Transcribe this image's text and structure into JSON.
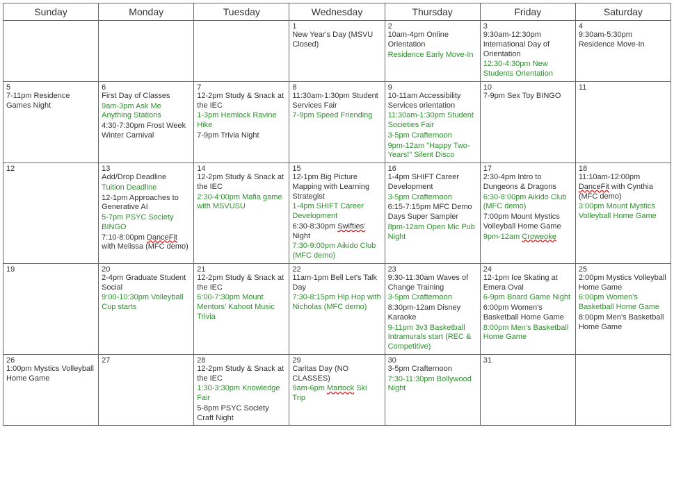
{
  "headers": [
    "Sunday",
    "Monday",
    "Tuesday",
    "Wednesday",
    "Thursday",
    "Friday",
    "Saturday"
  ],
  "weeks": [
    [
      {
        "num": "",
        "events": []
      },
      {
        "num": "",
        "events": []
      },
      {
        "num": "",
        "events": []
      },
      {
        "num": "1",
        "events": [
          {
            "text": "New Year's Day (MSVU Closed)",
            "color": "blk"
          }
        ]
      },
      {
        "num": "2",
        "events": [
          {
            "text": "10am-4pm Online Orientation",
            "color": "blk"
          },
          {
            "text": "Residence Early Move-In",
            "color": "grn"
          }
        ]
      },
      {
        "num": "3",
        "events": [
          {
            "text": "9:30am-12:30pm International Day of Orientation",
            "color": "blk"
          },
          {
            "text": "12:30-4:30pm New Students Orientation",
            "color": "grn"
          }
        ]
      },
      {
        "num": "4",
        "events": [
          {
            "text": "9:30am-5:30pm Residence Move-In",
            "color": "blk"
          }
        ]
      }
    ],
    [
      {
        "num": "5",
        "events": [
          {
            "text": "7-11pm Residence Games Night",
            "color": "blk"
          }
        ]
      },
      {
        "num": "6",
        "events": [
          {
            "text": "First Day of Classes",
            "color": "blk"
          },
          {
            "text": "9am-3pm Ask Me Anything Stations",
            "color": "grn"
          },
          {
            "text": "4:30-7:30pm Frost Week Winter Carnival",
            "color": "blk"
          }
        ]
      },
      {
        "num": "7",
        "events": [
          {
            "text": "12-2pm Study & Snack at the IEC",
            "color": "blk"
          },
          {
            "text": "1-3pm Hemlock Ravine Hike",
            "color": "grn"
          },
          {
            "text": "7-9pm Trivia Night",
            "color": "blk"
          }
        ]
      },
      {
        "num": "8",
        "events": [
          {
            "text": "11:30am-1:30pm Student Services Fair",
            "color": "blk"
          },
          {
            "text": "7-9pm Speed Friending",
            "color": "grn"
          }
        ]
      },
      {
        "num": "9",
        "events": [
          {
            "text": "10-11am Accessibility Services orientation",
            "color": "blk"
          },
          {
            "text": "11:30am-1:30pm Student Societies Fair",
            "color": "grn"
          },
          {
            "text": "3-5pm Crafternoon",
            "color": "grn"
          },
          {
            "text": "9pm-12am \"Happy Two-Years!\" Silent Disco",
            "color": "grn"
          }
        ]
      },
      {
        "num": "10",
        "events": [
          {
            "text": "7-9pm Sex Toy BINGO",
            "color": "blk"
          }
        ]
      },
      {
        "num": "11",
        "events": []
      }
    ],
    [
      {
        "num": "12",
        "events": []
      },
      {
        "num": "13",
        "events": [
          {
            "text": "Add/Drop Deadline",
            "color": "blk"
          },
          {
            "text": "Tuition Deadline",
            "color": "grn"
          },
          {
            "text": "12-1pm Approaches to Generative AI",
            "color": "blk"
          },
          {
            "text": "5-7pm PSYC Society BINGO",
            "color": "grn"
          },
          {
            "pre": "7:10-8:00pm ",
            "squig": "DanceFit",
            "post": " with Melissa (MFC demo)",
            "color": "blk"
          }
        ]
      },
      {
        "num": "14",
        "events": [
          {
            "text": "12-2pm Study & Snack at the IEC",
            "color": "blk"
          },
          {
            "text": "2:30-4:00pm Mafia game with MSVUSU",
            "color": "grn"
          }
        ]
      },
      {
        "num": "15",
        "events": [
          {
            "text": "12-1pm Big Picture Mapping with Learning Strategist",
            "color": "blk"
          },
          {
            "text": "1-4pm SHIFT Career Development",
            "color": "grn"
          },
          {
            "pre": "6:30-8:30pm ",
            "squig": "Swifties'",
            "post": " Night",
            "color": "blk"
          },
          {
            "text": "7:30-9:00pm Aikido Club (MFC demo)",
            "color": "grn"
          }
        ]
      },
      {
        "num": "16",
        "events": [
          {
            "text": "1-4pm SHIFT Career Development",
            "color": "blk"
          },
          {
            "text": "3-5pm Crafternoon",
            "color": "grn"
          },
          {
            "text": "6:15-7:15pm MFC Demo Days Super Sampler",
            "color": "blk"
          },
          {
            "text": "8pm-12am Open Mic Pub Night",
            "color": "grn"
          }
        ]
      },
      {
        "num": "17",
        "events": [
          {
            "text": "2:30-4pm Intro to Dungeons & Dragons",
            "color": "blk"
          },
          {
            "text": "6:30-8:00pm Aikido Club (MFC demo)",
            "color": "grn"
          },
          {
            "text": "7:00pm Mount Mystics Volleyball Home Game",
            "color": "blk"
          },
          {
            "pre": "9pm-12am ",
            "squig": "Croweoke",
            "post": "",
            "color": "grn"
          }
        ]
      },
      {
        "num": "18",
        "events": [
          {
            "pre": "11:10am-12:00pm ",
            "squig": "DanceFit",
            "post": " with Cynthia (MFC demo)",
            "color": "blk"
          },
          {
            "text": "3:00pm Mount Mystics Volleyball Home Game",
            "color": "grn"
          }
        ]
      }
    ],
    [
      {
        "num": "19",
        "events": []
      },
      {
        "num": "20",
        "events": [
          {
            "text": "2-4pm Graduate Student Social",
            "color": "blk"
          },
          {
            "text": "9:00-10:30pm Volleyball Cup starts",
            "color": "grn"
          }
        ]
      },
      {
        "num": "21",
        "events": [
          {
            "text": "12-2pm Study & Snack at the IEC",
            "color": "blk"
          },
          {
            "text": "6:00-7:30pm Mount Mentors' Kahoot Music Trivia",
            "color": "grn"
          }
        ]
      },
      {
        "num": "22",
        "events": [
          {
            "text": "11am-1pm Bell Let's Talk Day",
            "color": "blk"
          },
          {
            "text": "7:30-8:15pm Hip Hop with Nicholas (MFC demo)",
            "color": "grn"
          }
        ]
      },
      {
        "num": "23",
        "events": [
          {
            "text": "9:30-11:30am Waves of Change Training",
            "color": "blk"
          },
          {
            "text": "3-5pm Crafternoon",
            "color": "grn"
          },
          {
            "text": "8:30pm-12am Disney Karaoke",
            "color": "blk"
          },
          {
            "text": "9-11pm 3v3 Basketball Intramurals start (REC & Competitive)",
            "color": "grn"
          }
        ]
      },
      {
        "num": "24",
        "events": [
          {
            "text": "12-1pm Ice Skating at Emera Oval",
            "color": "blk"
          },
          {
            "text": "6-9pm Board Game Night",
            "color": "grn"
          },
          {
            "text": "6:00pm Women's Basketball Home Game",
            "color": "blk"
          },
          {
            "text": "8:00pm Men's Basketball Home Game",
            "color": "grn"
          }
        ]
      },
      {
        "num": "25",
        "events": [
          {
            "text": "2:00pm Mystics Volleyball Home Game",
            "color": "blk"
          },
          {
            "text": "6:00pm Women's Basketball Home Game",
            "color": "grn"
          },
          {
            "text": "8:00pm Men's Basketball Home Game",
            "color": "blk"
          }
        ]
      }
    ],
    [
      {
        "num": "26",
        "events": [
          {
            "text": "1:00pm Mystics Volleyball Home Game",
            "color": "blk"
          }
        ]
      },
      {
        "num": "27",
        "events": []
      },
      {
        "num": "28",
        "events": [
          {
            "text": "12-2pm Study & Snack at the IEC",
            "color": "blk"
          },
          {
            "text": "1:30-3:30pm Knowledge Fair",
            "color": "grn"
          },
          {
            "text": "5-8pm PSYC Society Craft Night",
            "color": "blk"
          }
        ]
      },
      {
        "num": "29",
        "events": [
          {
            "text": "Caritas Day (NO CLASSES)",
            "color": "blk"
          },
          {
            "pre": "9am-6pm ",
            "squig": "Martock",
            "post": " Ski Trip",
            "color": "grn"
          }
        ]
      },
      {
        "num": "30",
        "events": [
          {
            "text": "3-5pm Crafternoon",
            "color": "blk"
          },
          {
            "text": "7:30-11:30pm Bollywood Night",
            "color": "grn"
          }
        ]
      },
      {
        "num": "31",
        "events": []
      },
      {
        "num": "",
        "events": []
      }
    ]
  ]
}
